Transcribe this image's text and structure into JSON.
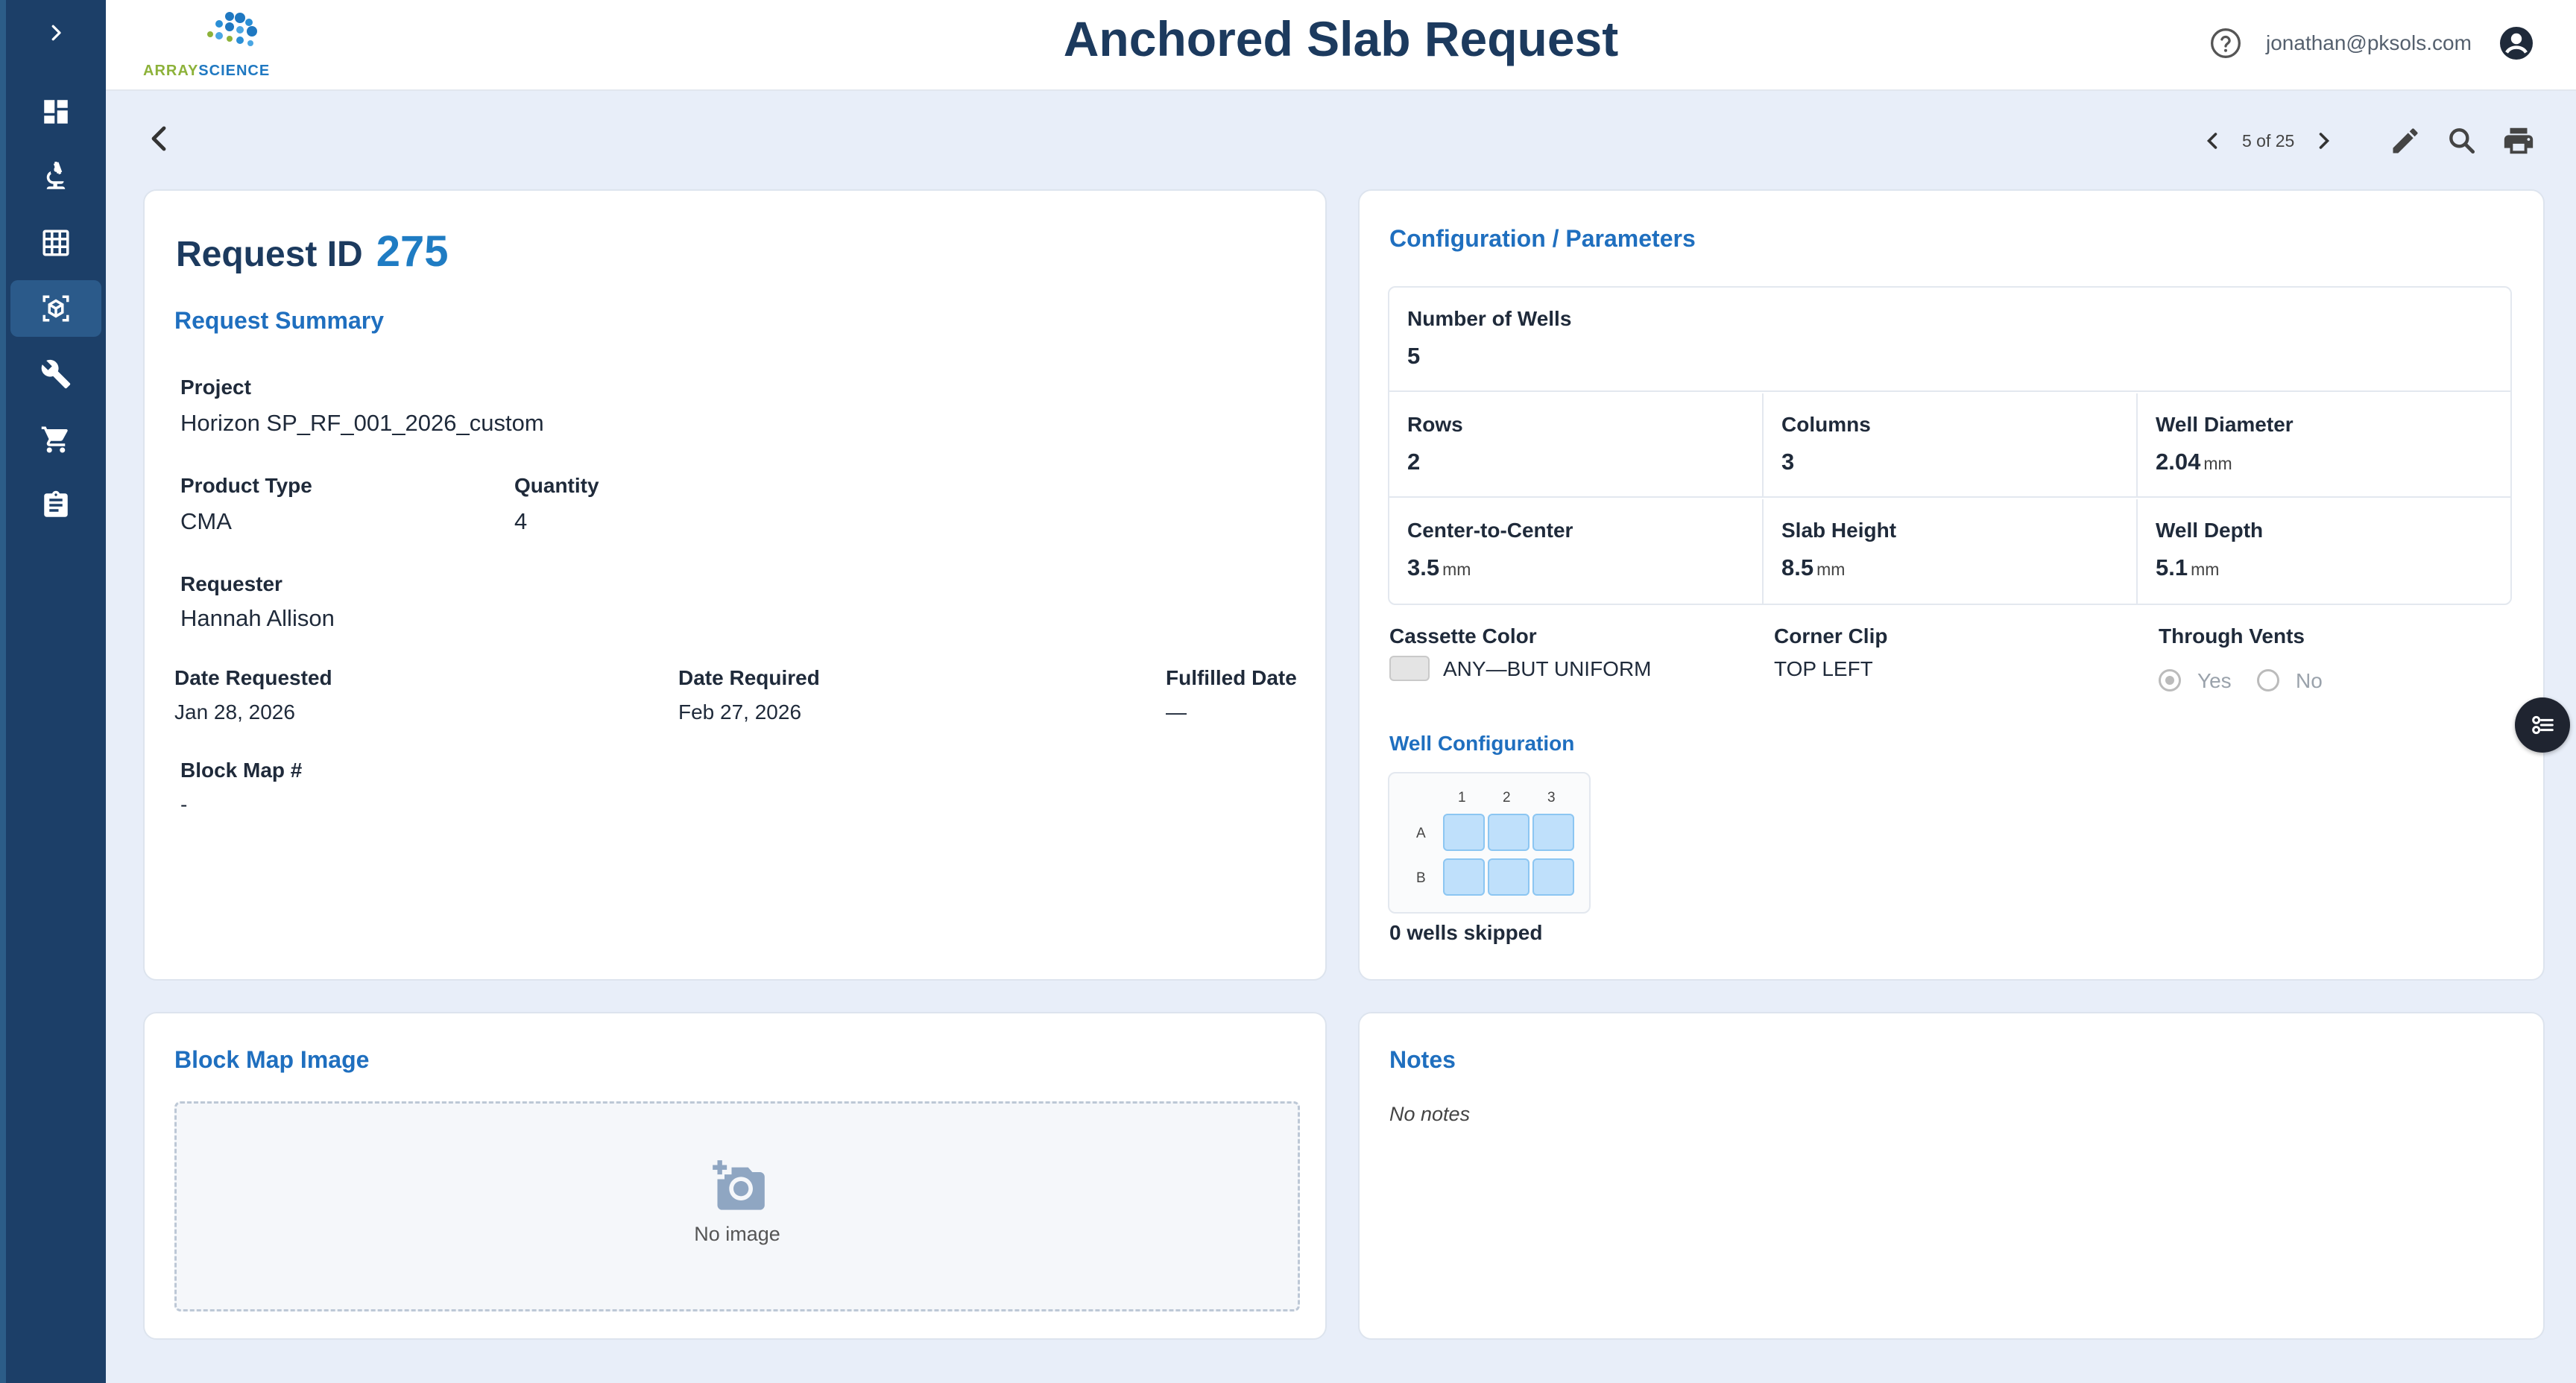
{
  "app": {
    "title": "Anchored Slab Request",
    "logo": {
      "part1": "ARRAY",
      "part2": "SCIENCE"
    }
  },
  "header": {
    "email": "jonathan@pksols.com"
  },
  "toolbar": {
    "pager_text": "5 of 25"
  },
  "request": {
    "id_label": "Request ID",
    "id": "275",
    "summary_title": "Request Summary",
    "project_label": "Project",
    "project": "Horizon SP_RF_001_2026_custom",
    "product_type_label": "Product Type",
    "product_type": "CMA",
    "quantity_label": "Quantity",
    "quantity": "4",
    "requester_label": "Requester",
    "requester": "Hannah Allison",
    "date_requested_label": "Date Requested",
    "date_requested": "Jan 28, 2026",
    "date_required_label": "Date Required",
    "date_required": "Feb 27, 2026",
    "fulfilled_label": "Fulfilled Date",
    "fulfilled": "—",
    "block_map_label": "Block Map #",
    "block_map": "-"
  },
  "config": {
    "title": "Configuration / Parameters",
    "wells_label": "Number of Wells",
    "wells": "5",
    "rows_label": "Rows",
    "rows": "2",
    "columns_label": "Columns",
    "columns": "3",
    "diameter_label": "Well Diameter",
    "diameter": "2.04",
    "ctc_label": "Center-to-Center",
    "ctc": "3.5",
    "slab_height_label": "Slab Height",
    "slab_height": "8.5",
    "depth_label": "Well Depth",
    "depth": "5.1",
    "unit": "mm",
    "cassette_label": "Cassette Color",
    "cassette": "ANY—BUT UNIFORM",
    "corner_label": "Corner Clip",
    "corner": "TOP LEFT",
    "vents_label": "Through Vents",
    "vents_yes": "Yes",
    "vents_no": "No",
    "well_config_title": "Well Configuration",
    "grid_cols": [
      "1",
      "2",
      "3"
    ],
    "grid_rows": [
      "A",
      "B"
    ],
    "skipped": "0 wells skipped"
  },
  "blockmap": {
    "title": "Block Map Image",
    "empty": "No image"
  },
  "notes": {
    "title": "Notes",
    "empty": "No notes"
  },
  "colors": {
    "accent": "#1f6fbf",
    "sidebar": "#1c3f68",
    "well": "#bfe0fb"
  }
}
